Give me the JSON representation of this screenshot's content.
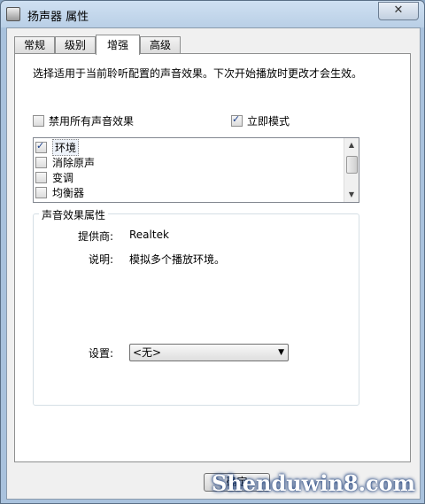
{
  "window": {
    "title": "扬声器 属性",
    "close_symbol": "✕"
  },
  "tabs": [
    {
      "label": "常规",
      "active": false
    },
    {
      "label": "级别",
      "active": false
    },
    {
      "label": "增强",
      "active": true
    },
    {
      "label": "高级",
      "active": false
    }
  ],
  "panel": {
    "description": "选择适用于当前聆听配置的声音效果。下次开始播放时更改才会生效。",
    "disable_all": {
      "label": "禁用所有声音效果",
      "checked": false
    },
    "immediate_mode": {
      "label": "立即模式",
      "checked": true
    },
    "effects": [
      {
        "label": "环境",
        "checked": true,
        "selected": true
      },
      {
        "label": "消除原声",
        "checked": false,
        "selected": false
      },
      {
        "label": "变调",
        "checked": false,
        "selected": false
      },
      {
        "label": "均衡器",
        "checked": false,
        "selected": false
      }
    ],
    "properties": {
      "group_title": "声音效果属性",
      "provider_label": "提供商:",
      "provider_value": "Realtek",
      "description_label": "说明:",
      "description_value": "模拟多个播放环境。",
      "setting_label": "设置:",
      "setting_value": "<无>"
    }
  },
  "buttons": {
    "ok": "确定"
  },
  "watermark": "Shenduwin8.com"
}
